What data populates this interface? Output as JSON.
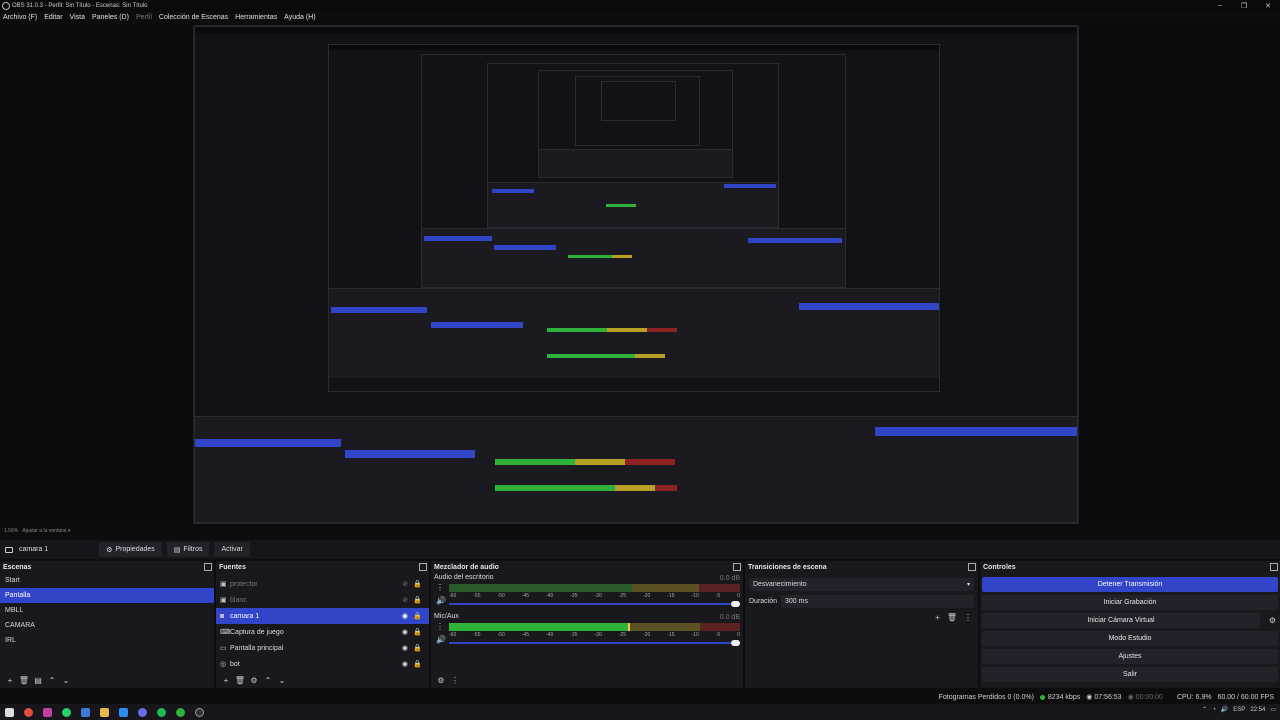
{
  "window": {
    "title": "OBS 31.0.3 - Perfil: Sin Título - Escenas: Sin Título"
  },
  "menu": [
    {
      "label": "Archivo (F)",
      "dim": false
    },
    {
      "label": "Editar",
      "dim": false
    },
    {
      "label": "Vista",
      "dim": false
    },
    {
      "label": "Paneles (D)",
      "dim": false
    },
    {
      "label": "Perfil",
      "dim": true
    },
    {
      "label": "Colección de Escenas",
      "dim": false
    },
    {
      "label": "Herramientas",
      "dim": false
    },
    {
      "label": "Ayuda (H)",
      "dim": false
    }
  ],
  "preview": {
    "scale_label": "1.56%",
    "fit_label": "Ajustar a la ventana"
  },
  "source_bar": {
    "name": "camara 1",
    "properties": "Propiedades",
    "filters": "Filtros",
    "activate": "Activar"
  },
  "scenes": {
    "title": "Escenas",
    "items": [
      "Start",
      "Pantalla",
      "MBLL",
      "CAMARA",
      "IRL"
    ],
    "selected": 1
  },
  "sources": {
    "title": "Fuentes",
    "items": [
      {
        "label": "protector",
        "icon": "image-icon",
        "dimmed": true,
        "selected": false
      },
      {
        "label": "blanc",
        "icon": "image-icon",
        "dimmed": true,
        "selected": false
      },
      {
        "label": "camara 1",
        "icon": "camera-icon",
        "dimmed": false,
        "selected": true
      },
      {
        "label": "Captura de juego",
        "icon": "gamepad-icon",
        "dimmed": false,
        "selected": false
      },
      {
        "label": "Pantalla principal",
        "icon": "monitor-icon",
        "dimmed": false,
        "selected": false
      },
      {
        "label": "bot",
        "icon": "globe-icon",
        "dimmed": false,
        "selected": false
      }
    ]
  },
  "mixer": {
    "title": "Mezclador de audio",
    "ticks": [
      "-60",
      "-55",
      "-50",
      "-45",
      "-40",
      "-35",
      "-30",
      "-25",
      "-20",
      "-15",
      "-10",
      "-5",
      "0"
    ],
    "channels": [
      {
        "name": "Audio del escritorio",
        "db": "0.0 dB",
        "level": 0.0
      },
      {
        "name": "Mic/Aux",
        "db": "0.0 dB",
        "level": 0.62
      }
    ]
  },
  "transitions": {
    "title": "Transiciones de escena",
    "selected": "Desvanecimiento",
    "duration_label": "Duración",
    "duration_value": "300 ms"
  },
  "controls": {
    "title": "Controles",
    "buttons": [
      "Detener Transmisión",
      "Iniciar Grabación",
      "Iniciar Cámara Virtual",
      "Modo Estudio",
      "Ajustes",
      "Salir"
    ]
  },
  "status": {
    "dropped": "Fotogramas Perdidos 0 (0.0%)",
    "bitrate": "8234 kbps",
    "live_time": "07:56:53",
    "rec_time": "00:00:00",
    "cpu": "CPU: 6.9%",
    "fps": "60.00 / 60.00 FPS"
  },
  "taskbar": {
    "lang": "ESP",
    "time": "22:54"
  },
  "colors": {
    "accent": "#3244c8",
    "meter_green": "#2fb23a",
    "meter_yellow": "#b7a025",
    "meter_red": "#8c2222"
  }
}
